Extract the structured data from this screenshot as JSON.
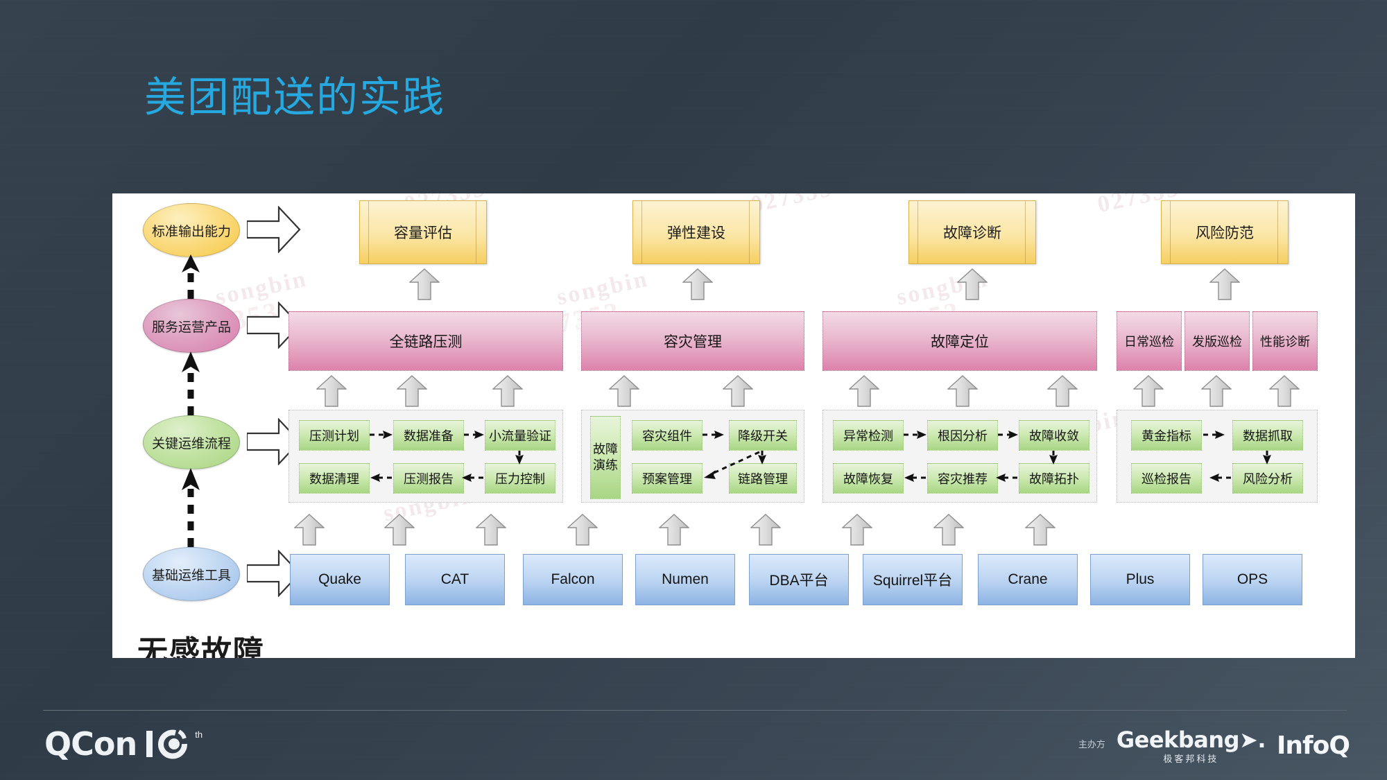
{
  "slide": {
    "title": "美团配送的实践",
    "title_color": "#26a9e0",
    "background_color": "#36424e"
  },
  "watermarks": [
    "songbin",
    "027353"
  ],
  "diagram": {
    "layers": [
      {
        "label": "标准输出能力",
        "color": "#f5c843",
        "shape": "ellipse"
      },
      {
        "label": "服务运营产品",
        "color": "#d87fae",
        "shape": "ellipse"
      },
      {
        "label": "关键运维流程",
        "color": "#a8d581",
        "shape": "ellipse"
      },
      {
        "label": "基础运维工具",
        "color": "#9dc0ea",
        "shape": "ellipse"
      }
    ],
    "capability_cards": [
      {
        "label": "容量评估"
      },
      {
        "label": "弹性建设"
      },
      {
        "label": "故障诊断"
      },
      {
        "label": "风险防范"
      }
    ],
    "product_bars": [
      {
        "label": "全链路压测"
      },
      {
        "label": "容灾管理"
      },
      {
        "label": "故障定位"
      },
      {
        "label": "日常巡检"
      },
      {
        "label": "发版巡检"
      },
      {
        "label": "性能诊断"
      }
    ],
    "process_groups": [
      {
        "name": "pressure-test-process",
        "top_row": [
          "压测计划",
          "数据准备",
          "小流量验证"
        ],
        "bottom_row": [
          "数据清理",
          "压测报告",
          "压力控制"
        ]
      },
      {
        "name": "disaster-recovery-process",
        "side_label": "故障演练",
        "side_label_lines": [
          "故障",
          "演练"
        ],
        "top_row": [
          "容灾组件",
          "降级开关"
        ],
        "bottom_row": [
          "预案管理",
          "链路管理"
        ]
      },
      {
        "name": "fault-location-process",
        "top_row": [
          "异常检测",
          "根因分析",
          "故障收敛"
        ],
        "bottom_row": [
          "故障恢复",
          "容灾推荐",
          "故障拓扑"
        ]
      },
      {
        "name": "inspection-process",
        "top_row": [
          "黄金指标",
          "数据抓取"
        ],
        "bottom_row": [
          "巡检报告",
          "风险分析"
        ]
      }
    ],
    "tools": [
      {
        "label": "Quake"
      },
      {
        "label": "CAT"
      },
      {
        "label": "Falcon"
      },
      {
        "label": "Numen"
      },
      {
        "label": "DBA平台"
      },
      {
        "label": "Squirrel平台"
      },
      {
        "label": "Crane"
      },
      {
        "label": "Plus"
      },
      {
        "label": "OPS"
      }
    ],
    "clipped_bottom_text": "无感故障"
  },
  "footer": {
    "qcon_word": "QCon",
    "qcon_anniversary": "10",
    "qcon_sup": "th",
    "host_label": "主办方",
    "geekbang_word": "Geekbang➤.",
    "geekbang_cn": "极客邦科技",
    "infoq_word": "InfoQ"
  }
}
